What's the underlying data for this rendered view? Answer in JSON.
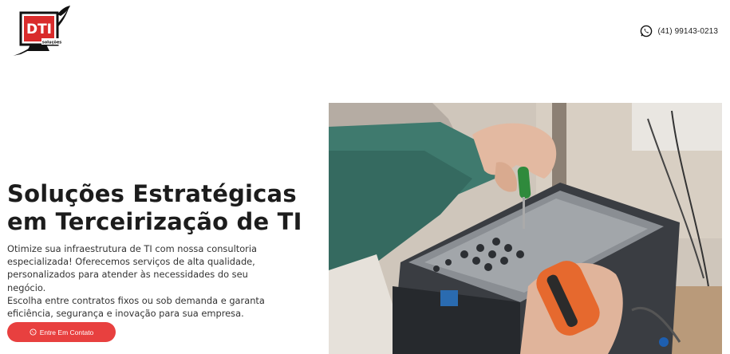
{
  "header": {
    "logo": {
      "text": "DTI",
      "subtext": "soluções"
    },
    "phone": {
      "icon": "whatsapp-icon",
      "number": "(41) 99143-0213"
    }
  },
  "hero": {
    "title_line1": "Soluções Estratégicas",
    "title_line2": "em Terceirização de TI",
    "description_lines": [
      "Otimize sua infraestrutura de TI com nossa consultoria",
      "especializada! Oferecemos serviços de alta qualidade,",
      "personalizados para atender às necessidades do seu negócio.",
      "Escolha entre contratos fixos ou sob demanda e garanta",
      "eficiência, segurança e inovação para sua empresa."
    ],
    "cta": {
      "icon": "whatsapp-icon",
      "label": "Entre Em Contato"
    }
  },
  "colors": {
    "accent": "#e8403f",
    "text": "#1c1c1c",
    "logo_red": "#d92b2b"
  }
}
